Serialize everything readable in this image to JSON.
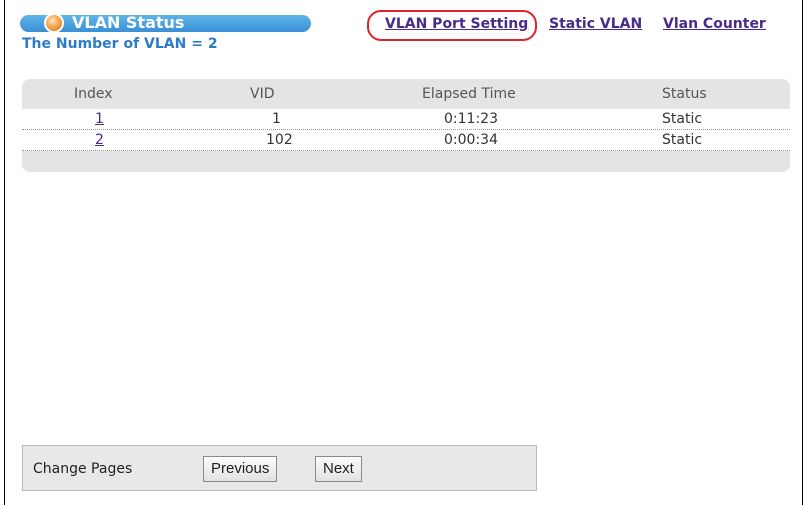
{
  "header": {
    "title": "VLAN Status",
    "vlan_count_label": "The Number of VLAN = 2"
  },
  "nav": {
    "port_setting": "VLAN Port Setting",
    "static_vlan": "Static VLAN",
    "vlan_counter": "Vlan Counter",
    "highlight_color": "#e0222a"
  },
  "table": {
    "columns": [
      "Index",
      "VID",
      "Elapsed Time",
      "Status"
    ],
    "rows": [
      {
        "index": "1",
        "vid": "1",
        "elapsed": "0:11:23",
        "status": "Static"
      },
      {
        "index": "2",
        "vid": "102",
        "elapsed": "0:00:34",
        "status": "Static"
      }
    ]
  },
  "pager": {
    "label": "Change Pages",
    "previous": "Previous",
    "next": "Next"
  },
  "colors": {
    "title_bar": "#3a8fd6",
    "link": "#4a2a8a",
    "count_text": "#2e7bc8"
  }
}
